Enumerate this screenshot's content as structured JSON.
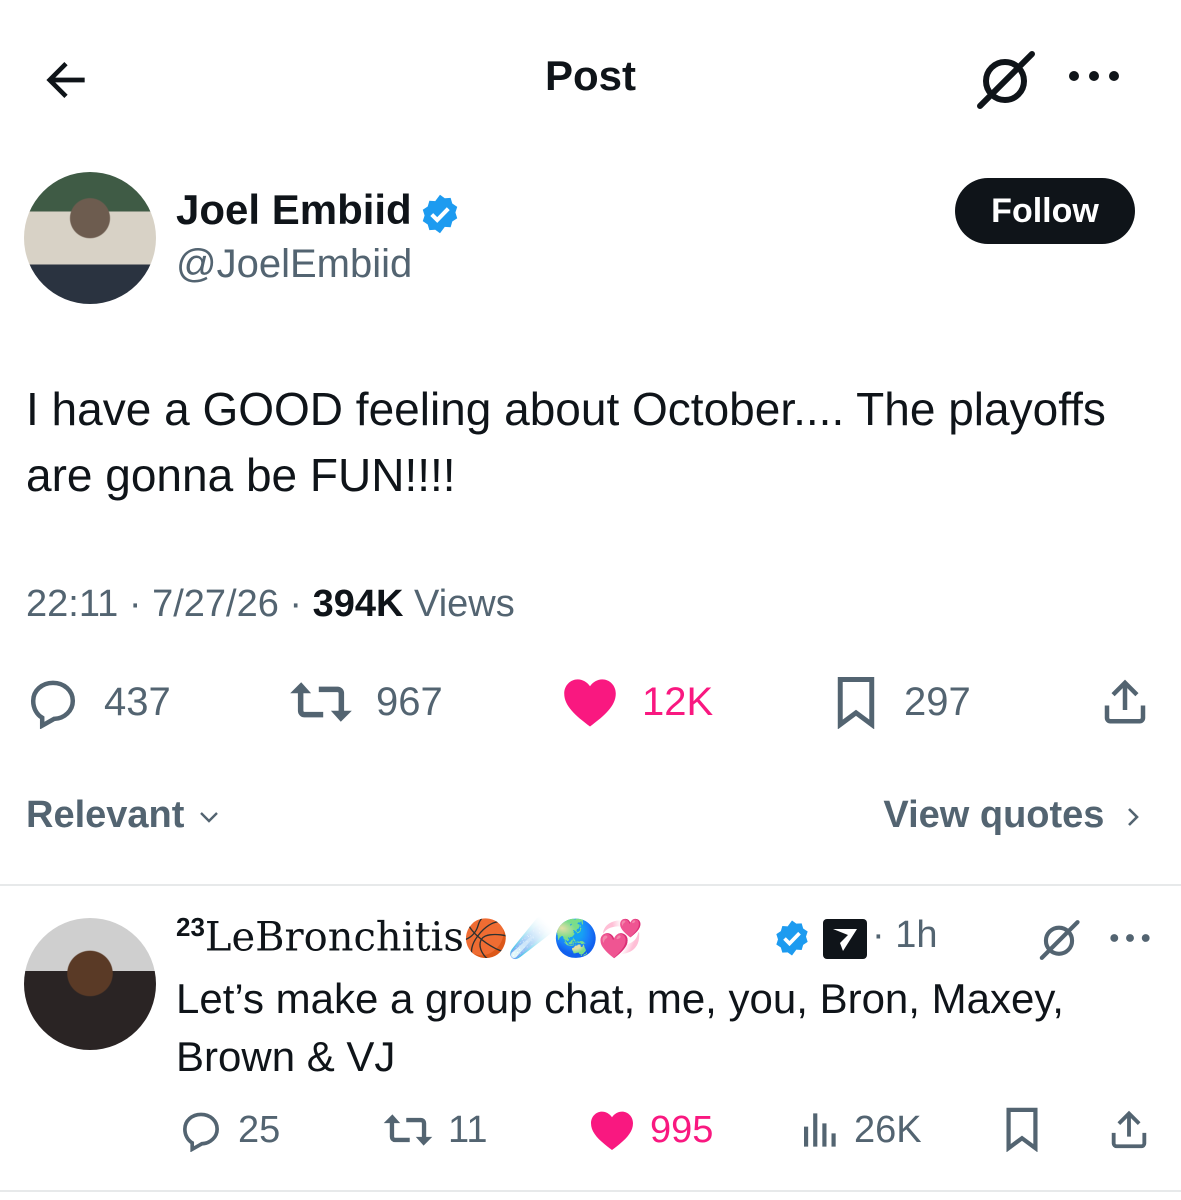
{
  "header": {
    "title": "Post"
  },
  "author": {
    "name": "Joel Embiid",
    "handle": "@JoelEmbiid",
    "follow_label": "Follow"
  },
  "post": {
    "text": "I have a GOOD feeling about October.... The playoffs are gonna be FUN!!!!",
    "time": "22:11",
    "date": "7/27/26",
    "views_count": "394K",
    "views_label": "Views"
  },
  "stats": {
    "replies": "437",
    "reposts": "967",
    "likes": "12K",
    "bookmarks": "297"
  },
  "replies_bar": {
    "sort": "Relevant",
    "view_quotes": "View quotes"
  },
  "reply": {
    "name_prefix": "23",
    "name": "LeBronchitis",
    "emojis": "🏀☄️🌏💞",
    "time": "1h",
    "text": "Let’s make a group chat, me, you, Bron, Maxey, Brown & VJ",
    "stats": {
      "replies": "25",
      "reposts": "11",
      "likes": "995",
      "views": "26K"
    }
  },
  "colors": {
    "accent": "#1d9bf0",
    "like": "#f91880",
    "text": "#0f1419",
    "secondary": "#536471"
  },
  "icons": [
    "back-arrow-icon",
    "grok-icon",
    "more-icon",
    "verified-badge-icon",
    "reply-icon",
    "repost-icon",
    "like-icon",
    "bookmark-icon",
    "share-icon",
    "chevron-down-icon",
    "chevron-right-icon",
    "analytics-icon"
  ]
}
